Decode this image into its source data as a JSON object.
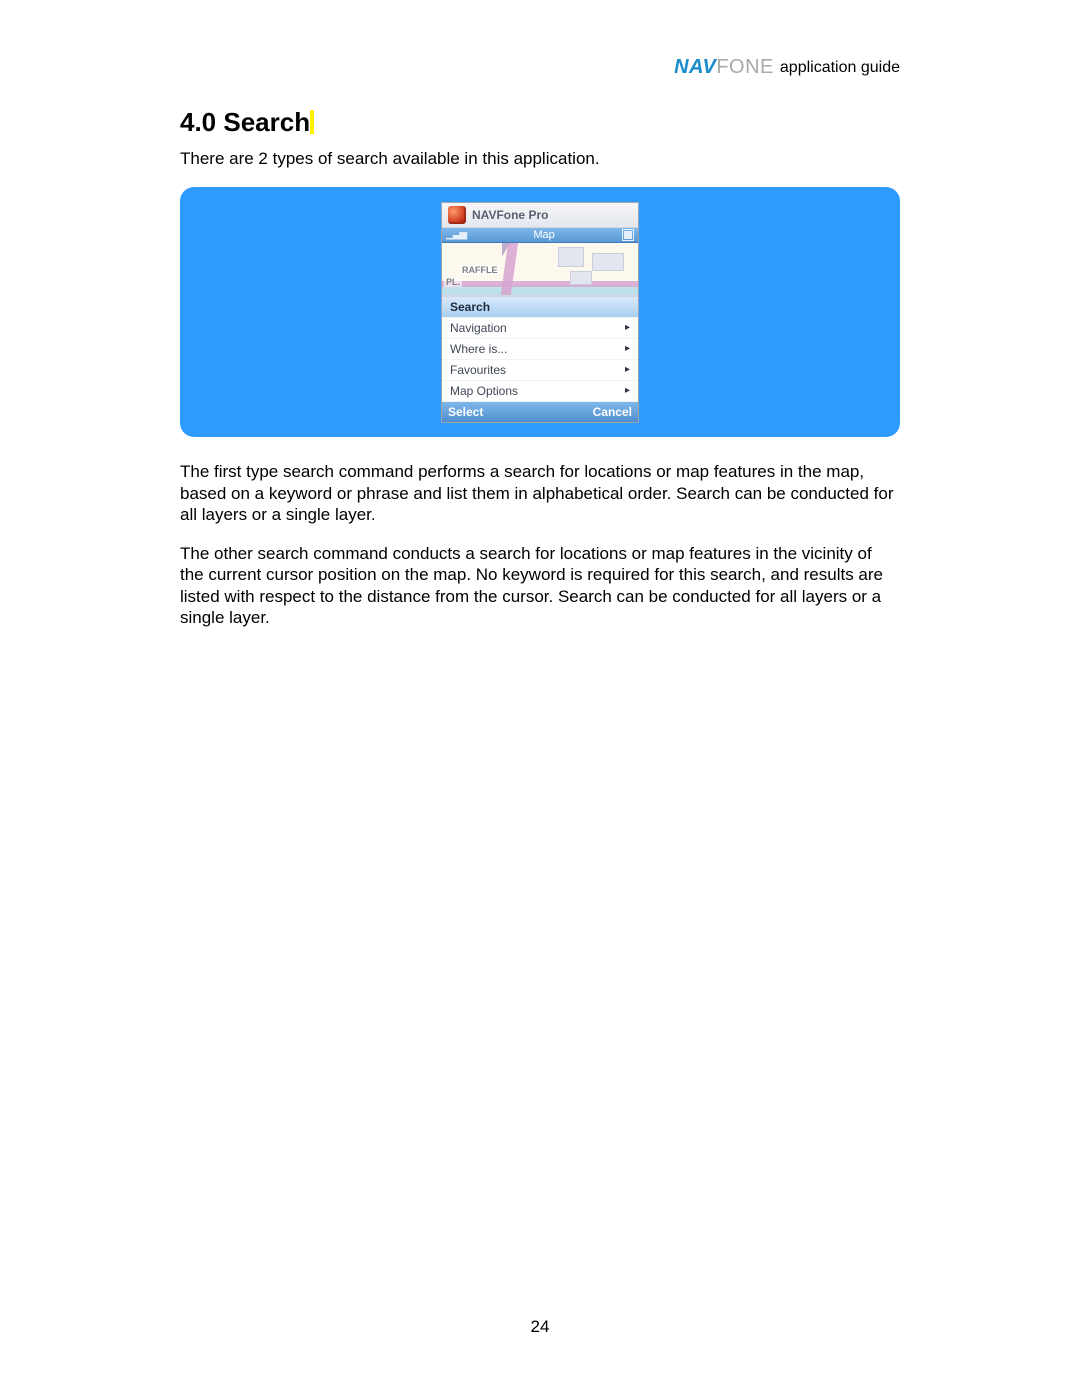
{
  "header": {
    "logo_nav": "NAV",
    "logo_fone": "FONE",
    "guide_label": "application guide"
  },
  "section": {
    "title": "4.0 Search",
    "intro": "There are 2 types of search available in this application.",
    "para1": "The first type search command performs a search for locations or map features in the map, based on a keyword or phrase and list them in alphabetical order. Search can be conducted for all layers or a single layer.",
    "para2": "The other search command conducts a search for locations or map features in the vicinity of the current cursor position on the map. No keyword is required for this search, and results are listed with respect to the distance from the cursor. Search can be conducted for all layers or a single layer."
  },
  "phone": {
    "app_title": "NAVFone Pro",
    "status_label": "Map",
    "map_labels": {
      "raffles": "RAFFLE",
      "pl": "PL."
    },
    "menu_items": [
      {
        "label": "Search",
        "selected": true,
        "has_sub": false
      },
      {
        "label": "Navigation",
        "selected": false,
        "has_sub": true
      },
      {
        "label": "Where is...",
        "selected": false,
        "has_sub": true
      },
      {
        "label": "Favourites",
        "selected": false,
        "has_sub": true
      },
      {
        "label": "Map Options",
        "selected": false,
        "has_sub": true
      }
    ],
    "softkeys": {
      "left": "Select",
      "right": "Cancel"
    }
  },
  "page_number": "24"
}
